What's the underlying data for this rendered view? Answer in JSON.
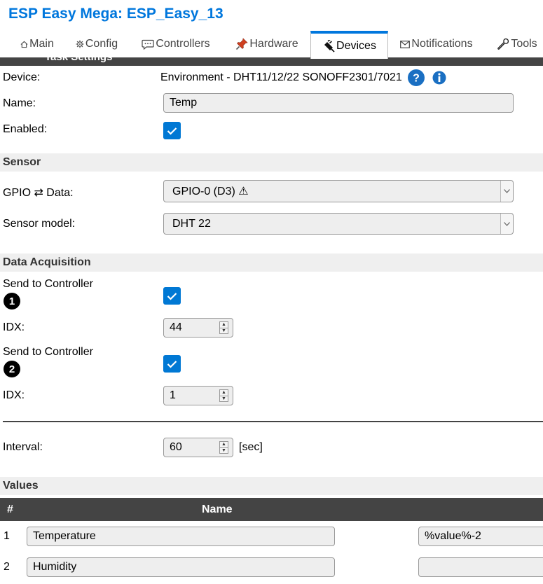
{
  "app": {
    "title": "ESP Easy Mega: ESP_Easy_13"
  },
  "tabs": [
    {
      "label": "Main",
      "icon": "home-icon"
    },
    {
      "label": "Config",
      "icon": "gear-icon"
    },
    {
      "label": "Controllers",
      "icon": "chat-icon"
    },
    {
      "label": "Hardware",
      "icon": "pin-icon"
    },
    {
      "label": "Devices",
      "icon": "plug-icon",
      "active": true
    },
    {
      "label": "Notifications",
      "icon": "mail-icon"
    },
    {
      "label": "Tools",
      "icon": "wrench-icon"
    }
  ],
  "panel": {
    "title": "Task Settings"
  },
  "device": {
    "device_label": "Device:",
    "device_value": "Environment - DHT11/12/22 SONOFF2301/7021",
    "name_label": "Name:",
    "name_value": "Temp",
    "enabled_label": "Enabled:",
    "enabled": true
  },
  "sensor": {
    "section_title": "Sensor",
    "gpio_label": "GPIO ⇄ Data:",
    "gpio_value": "GPIO-0 (D3) ⚠",
    "model_label": "Sensor model:",
    "model_value": "DHT 22"
  },
  "acquisition": {
    "section_title": "Data Acquisition",
    "controllers": [
      {
        "label": "Send to Controller",
        "badge": "1",
        "checked": true,
        "idx_label": "IDX:",
        "idx_value": "44"
      },
      {
        "label": "Send to Controller",
        "badge": "2",
        "checked": true,
        "idx_label": "IDX:",
        "idx_value": "1"
      }
    ],
    "interval_label": "Interval:",
    "interval_value": "60",
    "interval_unit": "[sec]"
  },
  "values": {
    "section_title": "Values",
    "col_num": "#",
    "col_name": "Name",
    "rows": [
      {
        "num": "1",
        "name": "Temperature",
        "formula": "%value%-2"
      },
      {
        "num": "2",
        "name": "Humidity",
        "formula": ""
      }
    ]
  },
  "colors": {
    "accent": "#0077dd",
    "checkbox": "#0078d4",
    "dark_bar": "#444444",
    "section_bg": "#efefef"
  }
}
